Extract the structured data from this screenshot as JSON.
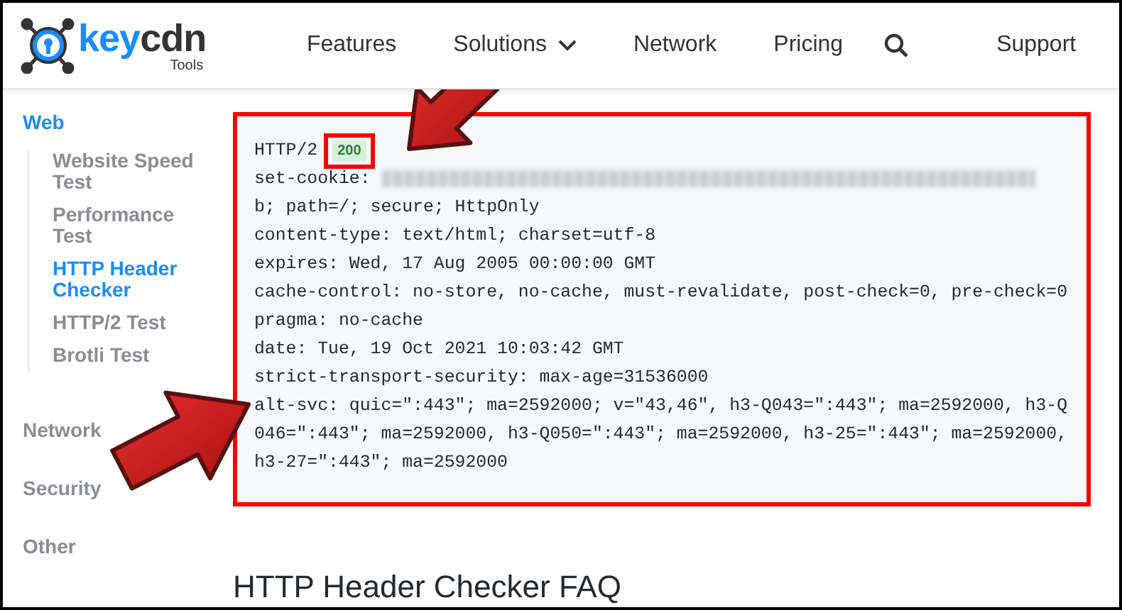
{
  "header": {
    "logo": {
      "brand_a": "key",
      "brand_b": "cdn",
      "sub": "Tools"
    },
    "nav": [
      {
        "kind": "link",
        "label": "Features"
      },
      {
        "kind": "dropdown",
        "label": "Solutions"
      },
      {
        "kind": "link",
        "label": "Network"
      },
      {
        "kind": "link",
        "label": "Pricing"
      },
      {
        "kind": "search"
      },
      {
        "kind": "link",
        "label": "Support"
      }
    ]
  },
  "sidebar": {
    "groups": [
      {
        "label": "Web",
        "selected": true,
        "children": [
          {
            "label": "Website Speed Test",
            "selected": false
          },
          {
            "label": "Performance Test",
            "selected": false
          },
          {
            "label": "HTTP Header Checker",
            "selected": true
          },
          {
            "label": "HTTP/2 Test",
            "selected": false
          },
          {
            "label": "Brotli Test",
            "selected": false
          }
        ]
      },
      {
        "label": "Network",
        "selected": false
      },
      {
        "label": "Security",
        "selected": false
      },
      {
        "label": "Other",
        "selected": false
      }
    ]
  },
  "result": {
    "lines": [
      {
        "kind": "status",
        "text": "HTTP/2",
        "badge": "200"
      },
      {
        "kind": "redacted",
        "text": "set-cookie:"
      },
      {
        "kind": "plain",
        "text": "b; path=/; secure; HttpOnly"
      },
      {
        "kind": "plain",
        "text": "content-type: text/html; charset=utf-8"
      },
      {
        "kind": "plain",
        "text": "expires: Wed, 17 Aug 2005 00:00:00 GMT"
      },
      {
        "kind": "plain",
        "text": "cache-control: no-store, no-cache, must-revalidate, post-check=0, pre-check=0"
      },
      {
        "kind": "plain",
        "text": "pragma: no-cache"
      },
      {
        "kind": "plain",
        "text": "date: Tue, 19 Oct 2021 10:03:42 GMT"
      },
      {
        "kind": "plain",
        "text": "strict-transport-security: max-age=31536000"
      },
      {
        "kind": "plain",
        "text": "alt-svc: quic=\":443\"; ma=2592000; v=\"43,46\", h3-Q043=\":443\"; ma=2592000, h3-Q"
      },
      {
        "kind": "plain",
        "text": "046=\":443\"; ma=2592000, h3-Q050=\":443\"; ma=2592000, h3-25=\":443\"; ma=2592000,"
      },
      {
        "kind": "plain",
        "text": "h3-27=\":443\"; ma=2592000"
      }
    ]
  },
  "faq_heading": "HTTP Header Checker FAQ"
}
